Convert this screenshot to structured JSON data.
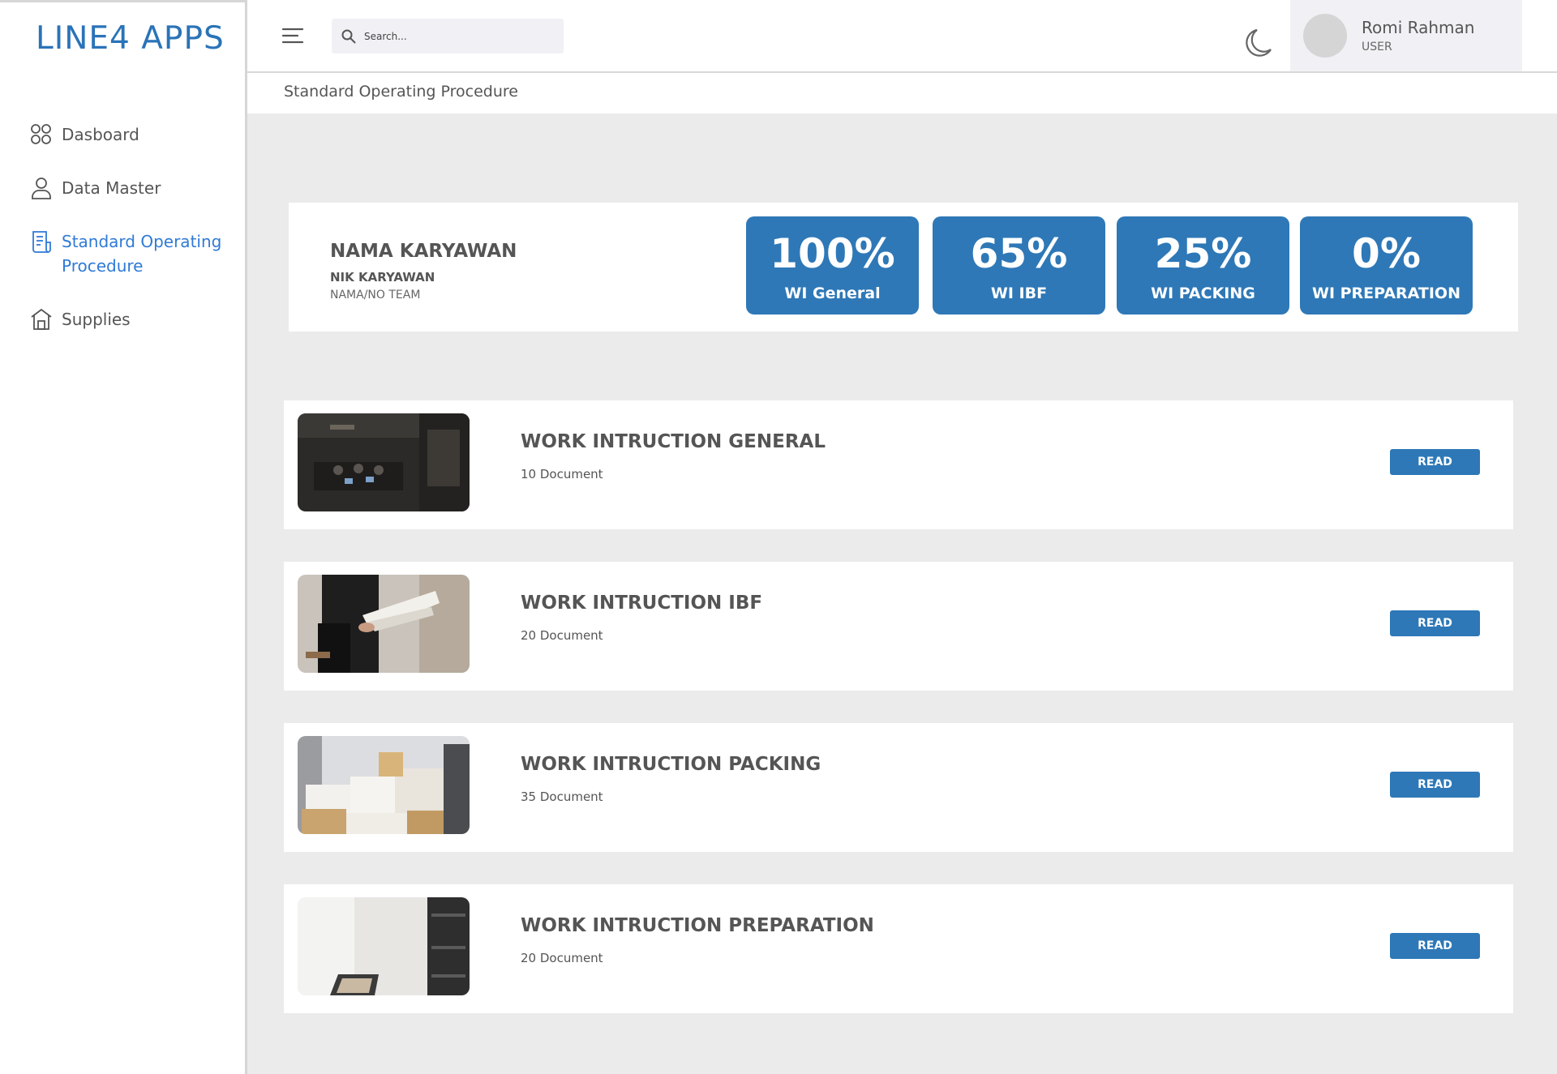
{
  "app": {
    "title": "LINE4 APPS"
  },
  "sidebar": {
    "items": [
      {
        "label": "Dasboard",
        "icon": "dashboard-grid-icon"
      },
      {
        "label": "Data Master",
        "icon": "user-icon"
      },
      {
        "label": "Standard Operating Procedure",
        "icon": "document-icon",
        "active": true
      },
      {
        "label": "Supplies",
        "icon": "home-icon"
      }
    ]
  },
  "header": {
    "search_placeholder": "Search...",
    "user": {
      "name": "Romi Rahman",
      "role": "USER"
    }
  },
  "breadcrumb": "Standard Operating Procedure",
  "profile": {
    "name": "NAMA KARYAWAN",
    "nik": "NIK KARYAWAN",
    "team": "NAMA/NO TEAM",
    "stats": [
      {
        "percent": "100%",
        "label": "WI General"
      },
      {
        "percent": "65%",
        "label": "WI IBF"
      },
      {
        "percent": "25%",
        "label": "WI PACKING"
      },
      {
        "percent": "0%",
        "label": "WI PREPARATION"
      }
    ]
  },
  "work_instructions": [
    {
      "title": "WORK INTRUCTION GENERAL",
      "count": "10 Document",
      "button": "READ"
    },
    {
      "title": "WORK INTRUCTION IBF",
      "count": "20 Document",
      "button": "READ"
    },
    {
      "title": "WORK INTRUCTION PACKING",
      "count": "35 Document",
      "button": "READ"
    },
    {
      "title": "WORK INTRUCTION PREPARATION",
      "count": "20 Document",
      "button": "READ"
    }
  ],
  "colors": {
    "accent": "#2e78b7",
    "active_nav": "#2f7ad6",
    "background": "#ebebeb"
  }
}
